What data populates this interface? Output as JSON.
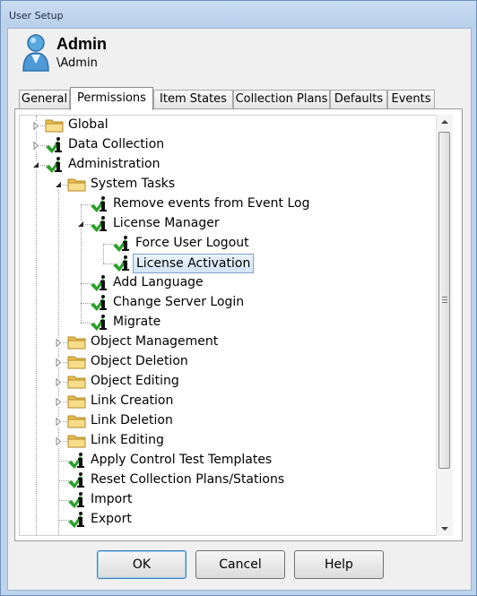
{
  "window": {
    "title": "User Setup"
  },
  "user": {
    "name": "Admin",
    "login": "\\Admin"
  },
  "tabs": [
    {
      "label": "General",
      "active": false
    },
    {
      "label": "Permissions",
      "active": true
    },
    {
      "label": "Item States",
      "active": false
    },
    {
      "label": "Collection Plans",
      "active": false
    },
    {
      "label": "Defaults",
      "active": false
    },
    {
      "label": "Events",
      "active": false
    }
  ],
  "tree": {
    "items": [
      {
        "label": "Global",
        "icon": "folder-icon",
        "expander": "collapsed",
        "selected": false
      },
      {
        "label": "Data Collection",
        "icon": "granted-permission-icon",
        "expander": "collapsed",
        "selected": false
      },
      {
        "label": "Administration",
        "icon": "granted-permission-icon",
        "expander": "expanded",
        "selected": false
      },
      {
        "label": "System Tasks",
        "icon": "folder-icon",
        "expander": "expanded",
        "selected": false
      },
      {
        "label": "Remove events from Event Log",
        "icon": "granted-permission-icon",
        "expander": "none",
        "selected": false
      },
      {
        "label": "License Manager",
        "icon": "granted-permission-icon",
        "expander": "expanded",
        "selected": false
      },
      {
        "label": "Force User Logout",
        "icon": "granted-permission-icon",
        "expander": "none",
        "selected": false
      },
      {
        "label": "License Activation",
        "icon": "granted-permission-icon",
        "expander": "none",
        "selected": true
      },
      {
        "label": "Add Language",
        "icon": "granted-permission-icon",
        "expander": "none",
        "selected": false
      },
      {
        "label": "Change Server Login",
        "icon": "granted-permission-icon",
        "expander": "none",
        "selected": false
      },
      {
        "label": "Migrate",
        "icon": "granted-permission-icon",
        "expander": "none",
        "selected": false
      },
      {
        "label": "Object Management",
        "icon": "folder-icon",
        "expander": "collapsed",
        "selected": false
      },
      {
        "label": "Object Deletion",
        "icon": "folder-icon",
        "expander": "collapsed",
        "selected": false
      },
      {
        "label": "Object Editing",
        "icon": "folder-icon",
        "expander": "collapsed",
        "selected": false
      },
      {
        "label": "Link Creation",
        "icon": "folder-icon",
        "expander": "collapsed",
        "selected": false
      },
      {
        "label": "Link Deletion",
        "icon": "folder-icon",
        "expander": "collapsed",
        "selected": false
      },
      {
        "label": "Link Editing",
        "icon": "folder-icon",
        "expander": "collapsed",
        "selected": false
      },
      {
        "label": "Apply Control Test Templates",
        "icon": "granted-permission-icon",
        "expander": "none",
        "selected": false
      },
      {
        "label": "Reset Collection Plans/Stations",
        "icon": "granted-permission-icon",
        "expander": "none",
        "selected": false
      },
      {
        "label": "Import",
        "icon": "granted-permission-icon",
        "expander": "none",
        "selected": false
      },
      {
        "label": "Export",
        "icon": "granted-permission-icon",
        "expander": "none",
        "selected": false
      }
    ]
  },
  "buttons": {
    "ok": "OK",
    "cancel": "Cancel",
    "help": "Help"
  },
  "colors": {
    "check": "#2aa02a",
    "folder": "#f2cf6b",
    "selection": "#d3e5f8"
  }
}
